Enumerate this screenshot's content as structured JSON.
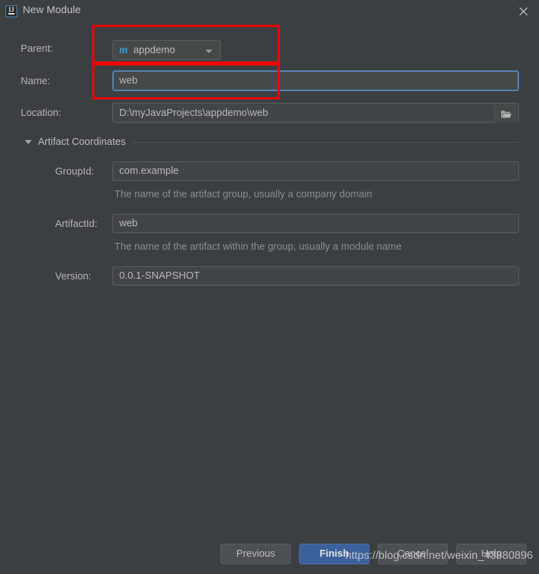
{
  "window": {
    "title": "New Module",
    "app_icon": "intellij-idea-icon",
    "icon_text": "IJ",
    "close_icon": "close-icon"
  },
  "form": {
    "parent": {
      "label": "Parent:",
      "icon": "maven-module-icon",
      "icon_text": "m",
      "value": "appdemo",
      "chevron_icon": "chevron-down-icon"
    },
    "name": {
      "label": "Name:",
      "value": "web"
    },
    "location": {
      "label": "Location:",
      "value": "D:\\myJavaProjects\\appdemo\\web",
      "browse_icon": "folder-open-icon"
    }
  },
  "artifact_coordinates": {
    "title": "Artifact Coordinates",
    "expanded_icon": "triangle-down-icon",
    "group_id": {
      "label": "GroupId:",
      "value": "com.example",
      "hint": "The name of the artifact group, usually a company domain"
    },
    "artifact_id": {
      "label": "ArtifactId:",
      "value": "web",
      "hint": "The name of the artifact within the group, usually a module name"
    },
    "version": {
      "label": "Version:",
      "value": "0.0.1-SNAPSHOT"
    }
  },
  "buttons": {
    "previous": "Previous",
    "finish": "Finish",
    "cancel": "Cancel",
    "help": "Help"
  },
  "watermark": {
    "text": "https://blog.csdn.net/weixin_43880896"
  },
  "colors": {
    "dialog_background": "#3c3f41",
    "field_background": "#45494a",
    "focus_border": "#5a87b8",
    "primary_button": "#3c6099",
    "annotation": "#fe0000",
    "maven_icon": "#3d9ad1"
  }
}
